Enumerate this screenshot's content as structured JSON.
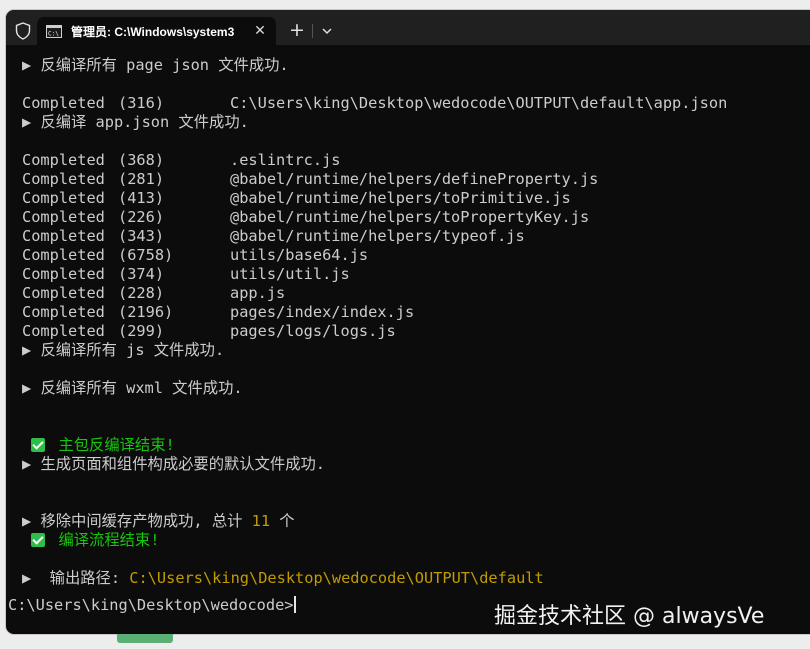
{
  "titlebar": {
    "tab_title": "管理员: C:\\Windows\\system3",
    "close_glyph": "✕",
    "new_tab_glyph": "+"
  },
  "terminal": {
    "lines": [
      {
        "kind": "info",
        "marker": "▶",
        "text": "反编译所有 page json 文件成功."
      },
      {
        "kind": "blank"
      },
      {
        "kind": "completed",
        "status": "Completed",
        "count": "(316)",
        "path": "C:\\Users\\king\\Desktop\\wedocode\\OUTPUT\\default\\app.json"
      },
      {
        "kind": "info",
        "marker": "▶",
        "text": "反编译 app.json 文件成功."
      },
      {
        "kind": "blank"
      },
      {
        "kind": "completed",
        "status": "Completed",
        "count": "(368)",
        "path": ".eslintrc.js"
      },
      {
        "kind": "completed",
        "status": "Completed",
        "count": "(281)",
        "path": "@babel/runtime/helpers/defineProperty.js"
      },
      {
        "kind": "completed",
        "status": "Completed",
        "count": "(413)",
        "path": "@babel/runtime/helpers/toPrimitive.js"
      },
      {
        "kind": "completed",
        "status": "Completed",
        "count": "(226)",
        "path": "@babel/runtime/helpers/toPropertyKey.js"
      },
      {
        "kind": "completed",
        "status": "Completed",
        "count": "(343)",
        "path": "@babel/runtime/helpers/typeof.js"
      },
      {
        "kind": "completed",
        "status": "Completed",
        "count": "(6758)",
        "path": "utils/base64.js"
      },
      {
        "kind": "completed",
        "status": "Completed",
        "count": "(374)",
        "path": "utils/util.js"
      },
      {
        "kind": "completed",
        "status": "Completed",
        "count": "(228)",
        "path": "app.js"
      },
      {
        "kind": "completed",
        "status": "Completed",
        "count": "(2196)",
        "path": "pages/index/index.js"
      },
      {
        "kind": "completed",
        "status": "Completed",
        "count": "(299)",
        "path": "pages/logs/logs.js"
      },
      {
        "kind": "info",
        "marker": "▶",
        "text": "反编译所有 js 文件成功."
      },
      {
        "kind": "blank"
      },
      {
        "kind": "info",
        "marker": "▶",
        "text": "反编译所有 wxml 文件成功."
      },
      {
        "kind": "blank"
      },
      {
        "kind": "blank"
      },
      {
        "kind": "success",
        "text": "主包反编译结束!"
      },
      {
        "kind": "info",
        "marker": "▶",
        "text": "生成页面和组件构成必要的默认文件成功."
      },
      {
        "kind": "blank"
      },
      {
        "kind": "blank"
      },
      {
        "kind": "counted",
        "marker": "▶",
        "text": "移除中间缓存产物成功, 总计 ",
        "count": "11",
        "suffix": " 个"
      },
      {
        "kind": "success",
        "text": "编译流程结束!"
      },
      {
        "kind": "blank"
      },
      {
        "kind": "output",
        "marker": "▶",
        "label": " 输出路径: ",
        "path": "C:\\Users\\king\\Desktop\\wedocode\\OUTPUT\\default"
      }
    ],
    "prompt": "C:\\Users\\king\\Desktop\\wedocode>"
  },
  "watermark": "掘金技术社区 @ alwaysVe",
  "colors": {
    "background": "#0c0c0c",
    "foreground": "#cccccc",
    "success": "#16c60c",
    "highlight": "#c19c00",
    "titlebar": "#202020"
  }
}
